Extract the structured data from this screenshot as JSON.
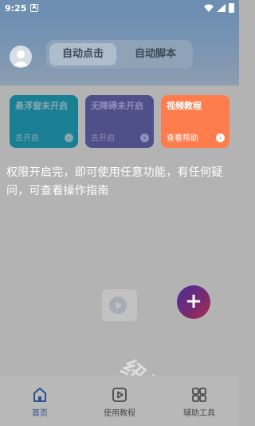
{
  "status_bar": {
    "time": "9:25",
    "notification_icon": "A"
  },
  "header": {
    "tabs": [
      {
        "label": "自动点击",
        "active": true
      },
      {
        "label": "自动脚本",
        "active": false
      }
    ]
  },
  "cards": [
    {
      "title": "悬浮窗未开启",
      "action": "去开启",
      "arrow": "›"
    },
    {
      "title": "无障碍未开启",
      "action": "去开启",
      "arrow": "›"
    },
    {
      "title": "视频教程",
      "action": "查看帮助",
      "arrow": "›"
    }
  ],
  "guide_tip": "权限开启完，即可使用任意功能，有任何疑问，可查看操作指南",
  "fab": {
    "label": "+"
  },
  "watermark": "纽扣助手",
  "bottom_nav": [
    {
      "label": "首页",
      "icon": "home-icon",
      "active": true
    },
    {
      "label": "使用教程",
      "icon": "play-icon",
      "active": false
    },
    {
      "label": "辅助工具",
      "icon": "tools-icon",
      "active": false
    }
  ],
  "colors": {
    "accent": "#2b4f8f",
    "card_video": "#ff7d4d",
    "card_float": "#1a7f93",
    "card_access": "#4f4f8a"
  }
}
